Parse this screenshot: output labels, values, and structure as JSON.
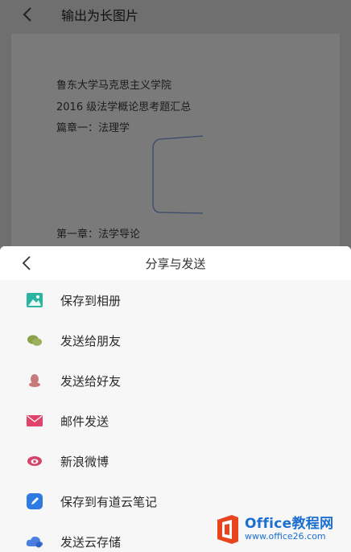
{
  "header": {
    "title": "输出为长图片"
  },
  "document": {
    "lines": [
      "鲁东大学马克思主义学院",
      "2016 级法学概论思考题汇总",
      "篇章一：法理学",
      "第一章：法学导论"
    ]
  },
  "sheet": {
    "title": "分享与发送",
    "items": [
      {
        "label": "保存到相册",
        "icon": "photo-album-icon",
        "color": "#2bb5a0"
      },
      {
        "label": "发送给朋友",
        "icon": "wechat-icon",
        "color": "#8aa04a"
      },
      {
        "label": "发送给好友",
        "icon": "qq-icon",
        "color": "#c77a7a"
      },
      {
        "label": "邮件发送",
        "icon": "mail-icon",
        "color": "#e2436a"
      },
      {
        "label": "新浪微博",
        "icon": "weibo-icon",
        "color": "#d6446a"
      },
      {
        "label": "保存到有道云笔记",
        "icon": "youdao-note-icon",
        "color": "#2d7be0"
      },
      {
        "label": "发送云存储",
        "icon": "cloud-storage-icon",
        "color": "#4a7fe0"
      }
    ]
  },
  "watermark": {
    "title": "Office教程网",
    "url": "www.office26.com",
    "color": "#1c6fd1"
  }
}
